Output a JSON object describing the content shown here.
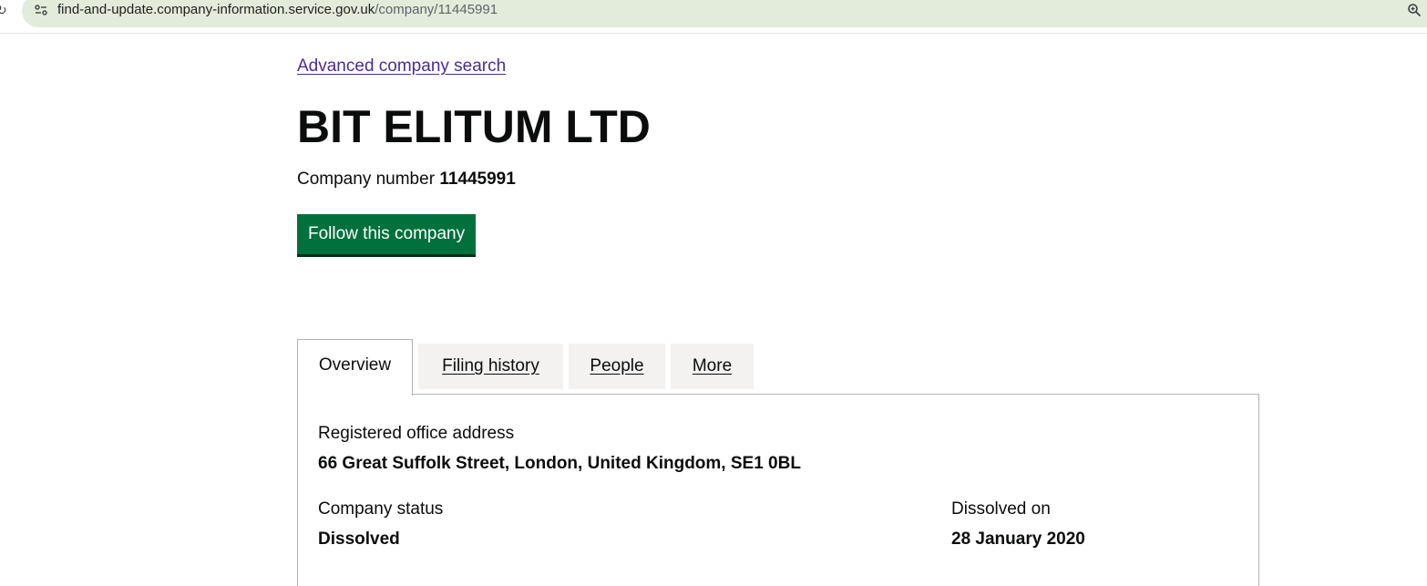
{
  "browser": {
    "url_host": "find-and-update.company-information.service.gov.uk",
    "url_path": "/company/11445991",
    "reload_icon": "reload-icon",
    "site_info_icon": "tune-icon",
    "zoom_icon": "zoom-icon"
  },
  "page": {
    "advanced_search_link": "Advanced company search",
    "company_name": "BIT ELITUM LTD",
    "company_number_label": "Company number",
    "company_number": "11445991",
    "follow_button": "Follow this company"
  },
  "tabs": [
    {
      "label": "Overview",
      "selected": true
    },
    {
      "label": "Filing history",
      "selected": false
    },
    {
      "label": "People",
      "selected": false
    },
    {
      "label": "More",
      "selected": false
    }
  ],
  "overview": {
    "registered_office_label": "Registered office address",
    "registered_office_value": "66 Great Suffolk Street, London, United Kingdom, SE1 0BL",
    "status_label": "Company status",
    "status_value": "Dissolved",
    "dissolved_label": "Dissolved on",
    "dissolved_value": "28 January 2020"
  },
  "colors": {
    "link": "#4c2c92",
    "button": "#00703c",
    "omnibox": "#e3ecdb",
    "tab_inactive": "#f3f2f1",
    "border": "#b1b4b6"
  }
}
